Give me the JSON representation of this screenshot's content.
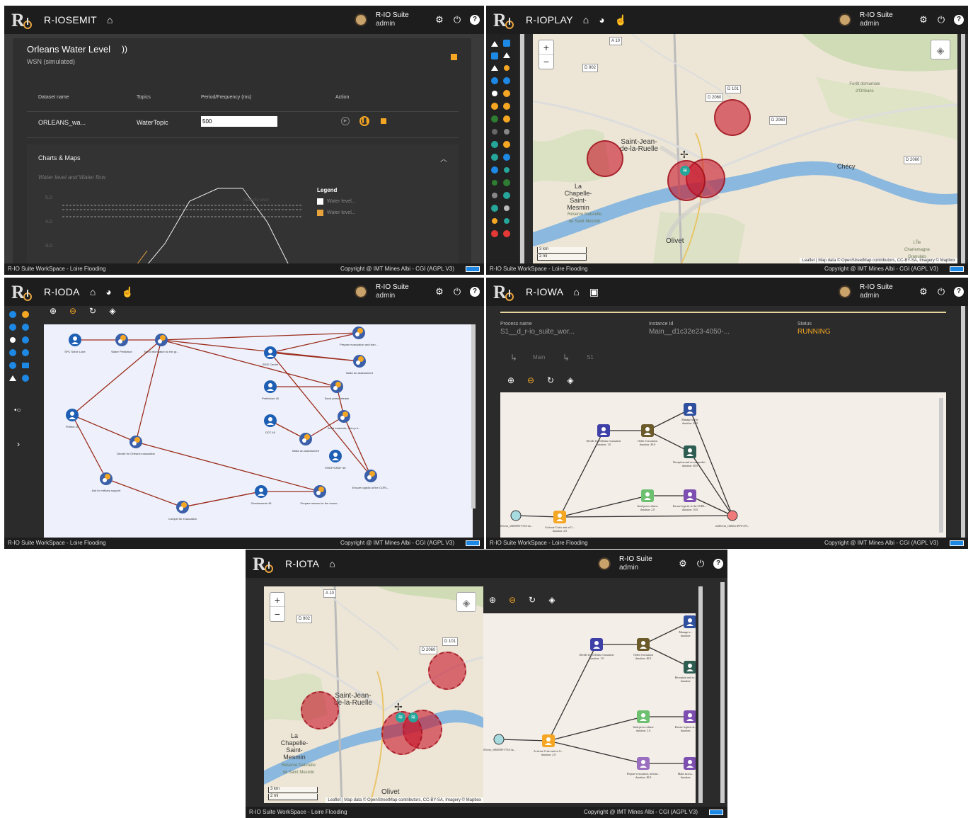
{
  "common": {
    "user_name": "R-IO Suite",
    "user_role": "admin",
    "footer_left": "R-IO Suite WorkSpace - Loire Flooding",
    "footer_right": "Copyright @ IMT Mines Albi - CGI (AGPL V3)"
  },
  "iosemit": {
    "title": "R-IOSEMIT",
    "dataset_title": "Orleans Water Level",
    "dataset_subtitle": "WSN  (simulated)",
    "table_headers": [
      "Dataset name",
      "Topics",
      "Period/Frequency (ms)",
      "Action"
    ],
    "row": {
      "name": "ORLEANS_wa...",
      "topic": "WaterTopic",
      "period": "500"
    },
    "charts_title": "Charts & Maps",
    "chart_subtitle": "Water level and Water flow",
    "legend_title": "Legend",
    "legend_items": [
      "Water level...",
      "Water level..."
    ],
    "legend_colors": [
      "#ffffff",
      "#e8a33d"
    ],
    "danger_label": "Security level",
    "y_ticks": [
      "5.0",
      "4.0",
      "3.0"
    ]
  },
  "ioplay": {
    "title": "R-IOPLAY",
    "towns": [
      "Saint-Jean-de-la-Ruelle",
      "Chécy",
      "La Chapelle-Saint-Mesmin",
      "Olivet",
      "Forêt domaniale d'Orléans",
      "Réserve Naturelle de Saint Mesmin",
      "L'Île Charlemagne Granulats"
    ],
    "roads": [
      "A 10",
      "D 902",
      "D 101",
      "D 2060",
      "D 2060",
      "D 2060"
    ],
    "scale": [
      "3 km",
      "2 mi"
    ],
    "attribution": "Leaflet | Map data © OpenStreetMap contributors, CC-BY-SA, Imagery © Mapbox"
  },
  "ioda": {
    "title": "R-IODA",
    "nodes": [
      {
        "label": "SPC Seine Loire"
      },
      {
        "label": "Water Prediction"
      },
      {
        "label": "Send information to the gr..."
      },
      {
        "label": "Prepare evacuation and tran..."
      },
      {
        "label": "SDIS Centre"
      },
      {
        "label": "Make an assessment"
      },
      {
        "label": "Prefecture 45"
      },
      {
        "label": "Send press release"
      },
      {
        "label": "Prefect 45"
      },
      {
        "label": "DDT 45"
      },
      {
        "label": "Send materials, set up tr..."
      },
      {
        "label": "Decide for Orleans evacuation"
      },
      {
        "label": "Make an assessment"
      },
      {
        "label": "ERDF/GRDF 45"
      },
      {
        "label": "Ensure logistic at the CORL..."
      },
      {
        "label": "Ask for military support"
      },
      {
        "label": "Gendarmerie 45"
      },
      {
        "label": "Prepare means for the evacu..."
      },
      {
        "label": "Compel for evacuation"
      }
    ]
  },
  "iowa": {
    "title": "R-IOWA",
    "process_label": "Process name",
    "process_value": "S1__d_r-io_suite_wor...",
    "instance_label": "Instance Id",
    "instance_value": "Main__d1c32e23-4050-...",
    "status_label": "Status",
    "status_value": "RUNNING",
    "breadcrumb": [
      "Main",
      "S1"
    ],
    "nodes": [
      {
        "label": "Decide for Orleans evacuation",
        "duration": "duration: 1.0"
      },
      {
        "label": "Order evacuation",
        "duration": "duration: 40.0"
      },
      {
        "label": "Manage traffic",
        "duration": "duration: 40.0"
      },
      {
        "label": "Reception and accommodat...",
        "duration": "duration: 40.0"
      },
      {
        "label": "Send press release",
        "duration": "duration: 2.0"
      },
      {
        "label": "Ensure logistic at the CORL...",
        "duration": "duration: 10.0"
      },
      {
        "label": "Activate Crisis unit at G...",
        "duration": "duration: 2.0"
      },
      {
        "label": "sfEvent_o0665f95-5734-4a...",
        "duration": ""
      },
      {
        "label": "endEvent_1b0b5a-d970-473...",
        "duration": ""
      }
    ]
  },
  "iota": {
    "title": "R-IOTA",
    "towns": [
      "Saint-Jean-de-la-Ruelle",
      "La Chapelle-Saint-Mesmin",
      "Olivet",
      "Réserve Naturelle de Saint Mesmin"
    ],
    "roads": [
      "A 10",
      "D 902",
      "D 101",
      "D 2060"
    ],
    "scale": [
      "3 km",
      "2 mi"
    ],
    "attribution": "Leaflet | Map data © OpenStreetMap contributors, CC-BY-SA, Imagery © Mapbox",
    "nodes": [
      {
        "label": "Decide for Orleans evacuation",
        "duration": "duration: 1.0"
      },
      {
        "label": "Order evacuation",
        "duration": "duration: 40.0"
      },
      {
        "label": "Manage tr...",
        "duration": "duration:"
      },
      {
        "label": "Reception and ac...",
        "duration": "duration:"
      },
      {
        "label": "Send press release",
        "duration": "duration: 2.0"
      },
      {
        "label": "Ensure logistic at...",
        "duration": "duration:"
      },
      {
        "label": "Activate Crisis unit at G...",
        "duration": "duration: 2.0"
      },
      {
        "label": "sfEvent_o0665f95-5734-4a...",
        "duration": ""
      },
      {
        "label": "Prepare evacuation, inform...",
        "duration": "duration: 40.0"
      },
      {
        "label": "Make an ass...",
        "duration": "duration:"
      }
    ]
  }
}
